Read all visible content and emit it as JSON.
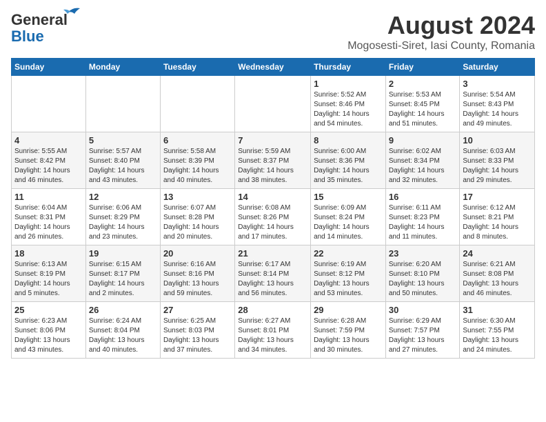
{
  "header": {
    "logo_line1": "General",
    "logo_line2": "Blue",
    "month_year": "August 2024",
    "location": "Mogosesti-Siret, Iasi County, Romania"
  },
  "days_of_week": [
    "Sunday",
    "Monday",
    "Tuesday",
    "Wednesday",
    "Thursday",
    "Friday",
    "Saturday"
  ],
  "weeks": [
    [
      {
        "day": "",
        "info": ""
      },
      {
        "day": "",
        "info": ""
      },
      {
        "day": "",
        "info": ""
      },
      {
        "day": "",
        "info": ""
      },
      {
        "day": "1",
        "info": "Sunrise: 5:52 AM\nSunset: 8:46 PM\nDaylight: 14 hours\nand 54 minutes."
      },
      {
        "day": "2",
        "info": "Sunrise: 5:53 AM\nSunset: 8:45 PM\nDaylight: 14 hours\nand 51 minutes."
      },
      {
        "day": "3",
        "info": "Sunrise: 5:54 AM\nSunset: 8:43 PM\nDaylight: 14 hours\nand 49 minutes."
      }
    ],
    [
      {
        "day": "4",
        "info": "Sunrise: 5:55 AM\nSunset: 8:42 PM\nDaylight: 14 hours\nand 46 minutes."
      },
      {
        "day": "5",
        "info": "Sunrise: 5:57 AM\nSunset: 8:40 PM\nDaylight: 14 hours\nand 43 minutes."
      },
      {
        "day": "6",
        "info": "Sunrise: 5:58 AM\nSunset: 8:39 PM\nDaylight: 14 hours\nand 40 minutes."
      },
      {
        "day": "7",
        "info": "Sunrise: 5:59 AM\nSunset: 8:37 PM\nDaylight: 14 hours\nand 38 minutes."
      },
      {
        "day": "8",
        "info": "Sunrise: 6:00 AM\nSunset: 8:36 PM\nDaylight: 14 hours\nand 35 minutes."
      },
      {
        "day": "9",
        "info": "Sunrise: 6:02 AM\nSunset: 8:34 PM\nDaylight: 14 hours\nand 32 minutes."
      },
      {
        "day": "10",
        "info": "Sunrise: 6:03 AM\nSunset: 8:33 PM\nDaylight: 14 hours\nand 29 minutes."
      }
    ],
    [
      {
        "day": "11",
        "info": "Sunrise: 6:04 AM\nSunset: 8:31 PM\nDaylight: 14 hours\nand 26 minutes."
      },
      {
        "day": "12",
        "info": "Sunrise: 6:06 AM\nSunset: 8:29 PM\nDaylight: 14 hours\nand 23 minutes."
      },
      {
        "day": "13",
        "info": "Sunrise: 6:07 AM\nSunset: 8:28 PM\nDaylight: 14 hours\nand 20 minutes."
      },
      {
        "day": "14",
        "info": "Sunrise: 6:08 AM\nSunset: 8:26 PM\nDaylight: 14 hours\nand 17 minutes."
      },
      {
        "day": "15",
        "info": "Sunrise: 6:09 AM\nSunset: 8:24 PM\nDaylight: 14 hours\nand 14 minutes."
      },
      {
        "day": "16",
        "info": "Sunrise: 6:11 AM\nSunset: 8:23 PM\nDaylight: 14 hours\nand 11 minutes."
      },
      {
        "day": "17",
        "info": "Sunrise: 6:12 AM\nSunset: 8:21 PM\nDaylight: 14 hours\nand 8 minutes."
      }
    ],
    [
      {
        "day": "18",
        "info": "Sunrise: 6:13 AM\nSunset: 8:19 PM\nDaylight: 14 hours\nand 5 minutes."
      },
      {
        "day": "19",
        "info": "Sunrise: 6:15 AM\nSunset: 8:17 PM\nDaylight: 14 hours\nand 2 minutes."
      },
      {
        "day": "20",
        "info": "Sunrise: 6:16 AM\nSunset: 8:16 PM\nDaylight: 13 hours\nand 59 minutes."
      },
      {
        "day": "21",
        "info": "Sunrise: 6:17 AM\nSunset: 8:14 PM\nDaylight: 13 hours\nand 56 minutes."
      },
      {
        "day": "22",
        "info": "Sunrise: 6:19 AM\nSunset: 8:12 PM\nDaylight: 13 hours\nand 53 minutes."
      },
      {
        "day": "23",
        "info": "Sunrise: 6:20 AM\nSunset: 8:10 PM\nDaylight: 13 hours\nand 50 minutes."
      },
      {
        "day": "24",
        "info": "Sunrise: 6:21 AM\nSunset: 8:08 PM\nDaylight: 13 hours\nand 46 minutes."
      }
    ],
    [
      {
        "day": "25",
        "info": "Sunrise: 6:23 AM\nSunset: 8:06 PM\nDaylight: 13 hours\nand 43 minutes."
      },
      {
        "day": "26",
        "info": "Sunrise: 6:24 AM\nSunset: 8:04 PM\nDaylight: 13 hours\nand 40 minutes."
      },
      {
        "day": "27",
        "info": "Sunrise: 6:25 AM\nSunset: 8:03 PM\nDaylight: 13 hours\nand 37 minutes."
      },
      {
        "day": "28",
        "info": "Sunrise: 6:27 AM\nSunset: 8:01 PM\nDaylight: 13 hours\nand 34 minutes."
      },
      {
        "day": "29",
        "info": "Sunrise: 6:28 AM\nSunset: 7:59 PM\nDaylight: 13 hours\nand 30 minutes."
      },
      {
        "day": "30",
        "info": "Sunrise: 6:29 AM\nSunset: 7:57 PM\nDaylight: 13 hours\nand 27 minutes."
      },
      {
        "day": "31",
        "info": "Sunrise: 6:30 AM\nSunset: 7:55 PM\nDaylight: 13 hours\nand 24 minutes."
      }
    ]
  ]
}
